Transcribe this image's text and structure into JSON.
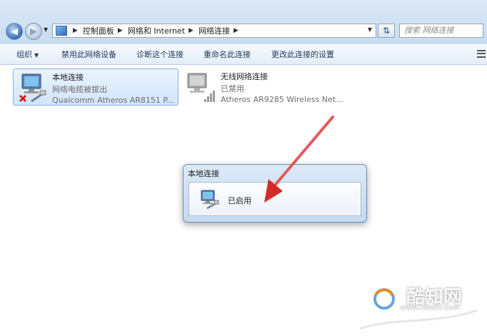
{
  "breadcrumb": [
    "控制面板",
    "网络和 Internet",
    "网络连接"
  ],
  "search": {
    "placeholder": "搜索 网络连接"
  },
  "toolbar": {
    "organize": "组织",
    "disable_device": "禁用此网络设备",
    "diagnose": "诊断这个连接",
    "rename": "重命名此连接",
    "change_settings": "更改此连接的设置"
  },
  "connections": [
    {
      "name": "本地连接",
      "status": "网络电缆被拔出",
      "device": "Qualcomm Atheros AR8151 P...",
      "icon": "ethernet-disconnected-icon"
    },
    {
      "name": "无线网络连接",
      "status": "已禁用",
      "device": "Atheros AR9285 Wireless Net...",
      "icon": "wireless-disabled-icon"
    }
  ],
  "popup": {
    "title": "本地连接",
    "status": "已启用",
    "icon": "network-adapter-icon"
  },
  "watermark": {
    "name": "酷知网",
    "url": "www.coozhi.com"
  },
  "colors": {
    "arrow": "#e23b3b",
    "selection": "#d2e5f9",
    "header": "#c9dcf0"
  }
}
